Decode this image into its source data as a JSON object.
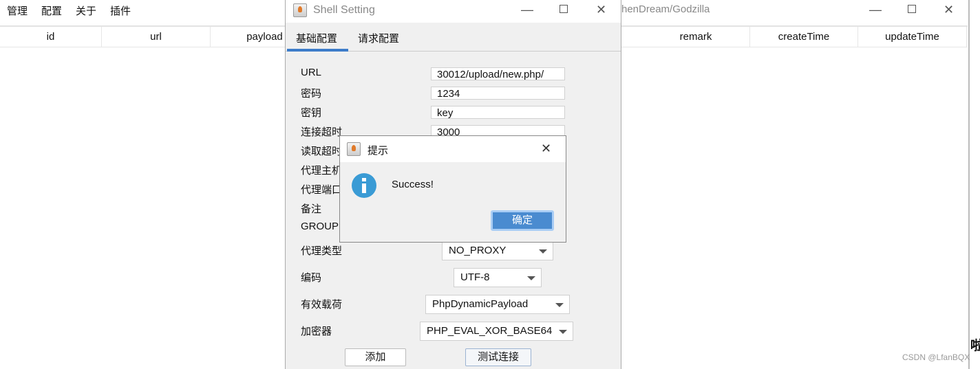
{
  "main_window": {
    "title_partial": "henDream/Godzilla",
    "menu": [
      "管理",
      "配置",
      "关于",
      "插件"
    ],
    "columns": [
      "id",
      "url",
      "payload",
      "remark",
      "createTime",
      "updateTime"
    ]
  },
  "shell_setting": {
    "title": "Shell Setting",
    "tabs": [
      "基础配置",
      "请求配置"
    ],
    "active_tab": "基础配置",
    "fields": [
      {
        "label": "URL",
        "value": "30012/upload/new.php/"
      },
      {
        "label": "密码",
        "value": "1234"
      },
      {
        "label": "密钥",
        "value": "key"
      },
      {
        "label": "连接超时",
        "value": "3000"
      },
      {
        "label": "读取超时"
      },
      {
        "label": "代理主机"
      },
      {
        "label": "代理端口"
      },
      {
        "label": "备注"
      },
      {
        "label": "GROUP"
      }
    ],
    "selects": [
      {
        "label": "代理类型",
        "value": "NO_PROXY"
      },
      {
        "label": "编码",
        "value": "UTF-8"
      },
      {
        "label": "有效载荷",
        "value": "PhpDynamicPayload"
      },
      {
        "label": "加密器",
        "value": "PHP_EVAL_XOR_BASE64"
      }
    ],
    "add_button": "添加",
    "test_button": "测试连接"
  },
  "message_dialog": {
    "title": "提示",
    "message": "Success!",
    "ok_button": "确定",
    "icon": "info-icon",
    "icon_color": "#3a9bd5",
    "button_color": "#4a8bd0"
  },
  "background": {
    "partial_text": "啦",
    "watermark": "CSDN @LfanBQX"
  },
  "accent_color": "#3d7cc9"
}
